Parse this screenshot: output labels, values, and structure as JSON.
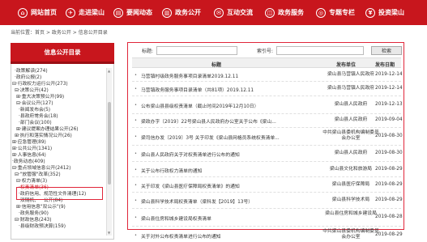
{
  "nav": {
    "items": [
      {
        "icon": "home-icon",
        "glyph": "⌂",
        "label": "网站首页"
      },
      {
        "icon": "walk-icon",
        "glyph": "✈",
        "label": "走进梁山"
      },
      {
        "icon": "news-icon",
        "glyph": "▤",
        "label": "要闻动态"
      },
      {
        "icon": "government-icon",
        "glyph": "▥",
        "label": "政务公开"
      },
      {
        "icon": "chat-icon",
        "glyph": "✉",
        "label": "互动交流"
      },
      {
        "icon": "service-icon",
        "glyph": "◫",
        "label": "政务服务"
      },
      {
        "icon": "topic-icon",
        "glyph": "◎",
        "label": "专题专栏"
      },
      {
        "icon": "invest-icon",
        "glyph": "¥",
        "label": "投资梁山"
      }
    ]
  },
  "breadcrumb": {
    "prefix": "当前位置：",
    "home": "首页",
    "sep1": " > ",
    "level1": "政务公开",
    "sep2": " > ",
    "level2": "信息公开目录"
  },
  "sidebar": {
    "title": "信息公开目录",
    "tree": [
      "·政策解读(274)",
      "·政府公报(2)",
      "⊟·行政权力运行公开(273)",
      "  ⊟·决策公开(42)",
      "    ⊞·重大决策预公开(99)",
      "    ⊟·会议公开(127)",
      "        ·新闻发布会(5)",
      "        ·县政府常务会(18)",
      "        ·部门会议(100)",
      "    ⊞·建议提案办理结果公开(26)",
      "  ⊞·执行和落实情况公开(26)",
      "⊞·应急管理(89)",
      "⊞·公共公开(1341)",
      "⊞·人事信息(64)",
      "·政务动态(409)",
      "⊟·重点领域信息公开(2412)",
      "  ⊟·\"放管服\"改革(352)",
      "    ⊟·权力清单(3)",
      "        ·权责清单(36)",
      "      ·政府信用、规范性文件清理(12)",
      "      ·双随机、一公开(84)",
      "    ⊞·信用信息\"双公示\"(9)",
      "      ·政务服务(90)",
      "  ⊟·财政信息(243)",
      "      ·县级财政预决算(159)"
    ]
  },
  "search": {
    "keyword_label": "标题:",
    "index_label": "索引号:",
    "button": "检索"
  },
  "table": {
    "headers": {
      "title": "标题",
      "unit": "发布单位",
      "date": "发布日期"
    },
    "rows": [
      {
        "title": "马营镇村级政务服务事项目录清单2019.12.11",
        "unit": "梁山县马营镇人民政府",
        "date": "2019-12-14"
      },
      {
        "title": "马营镇政务服务事项目录清单（共81项）2019.12.11",
        "unit": "梁山县马营镇人民政府",
        "date": "2019-12-14"
      },
      {
        "title": "公布梁山县县级权责清单（截止时间2019年12月10日）",
        "unit": "梁山县人民政府",
        "date": "2019-12-13"
      },
      {
        "title": "梁政办字〔2019〕22号梁山县人民政府办公室关于公布《梁山...",
        "unit": "梁山县人民政府",
        "date": "2019-09-04"
      },
      {
        "title": "梁司信办发〔2019〕3号 关于印发《梁山县网格员系统权责清单...",
        "unit": "中共梁山县委机构编制委员会办公室",
        "date": "2019-08-30"
      },
      {
        "title": "梁山县人民政府关于对权责清单进行公布的通知",
        "unit": "梁山县人民政府",
        "date": "2019-08-30"
      },
      {
        "title": "关于公布行政权力清单的通知",
        "unit": "梁山县文化和旅游局",
        "date": "2019-08-29"
      },
      {
        "title": "关于印发《梁山县医疗保障局权责清单》的通知",
        "unit": "梁山县医疗保障局",
        "date": "2019-08-29"
      },
      {
        "title": "梁山县科学技术局权责清单（梁科发【2019】13号）",
        "unit": "梁山县科学技术局",
        "date": "2019-08-29"
      },
      {
        "title": "梁山县住房和城乡建设局权责清单",
        "unit": "梁山县住房和城乡建设局",
        "date": "2019-08-28"
      },
      {
        "title": "关于对外公布权责清单进行公布的通知",
        "unit": "中共梁山县委机构编制委员会办公室",
        "date": "2019-08-29"
      }
    ]
  }
}
